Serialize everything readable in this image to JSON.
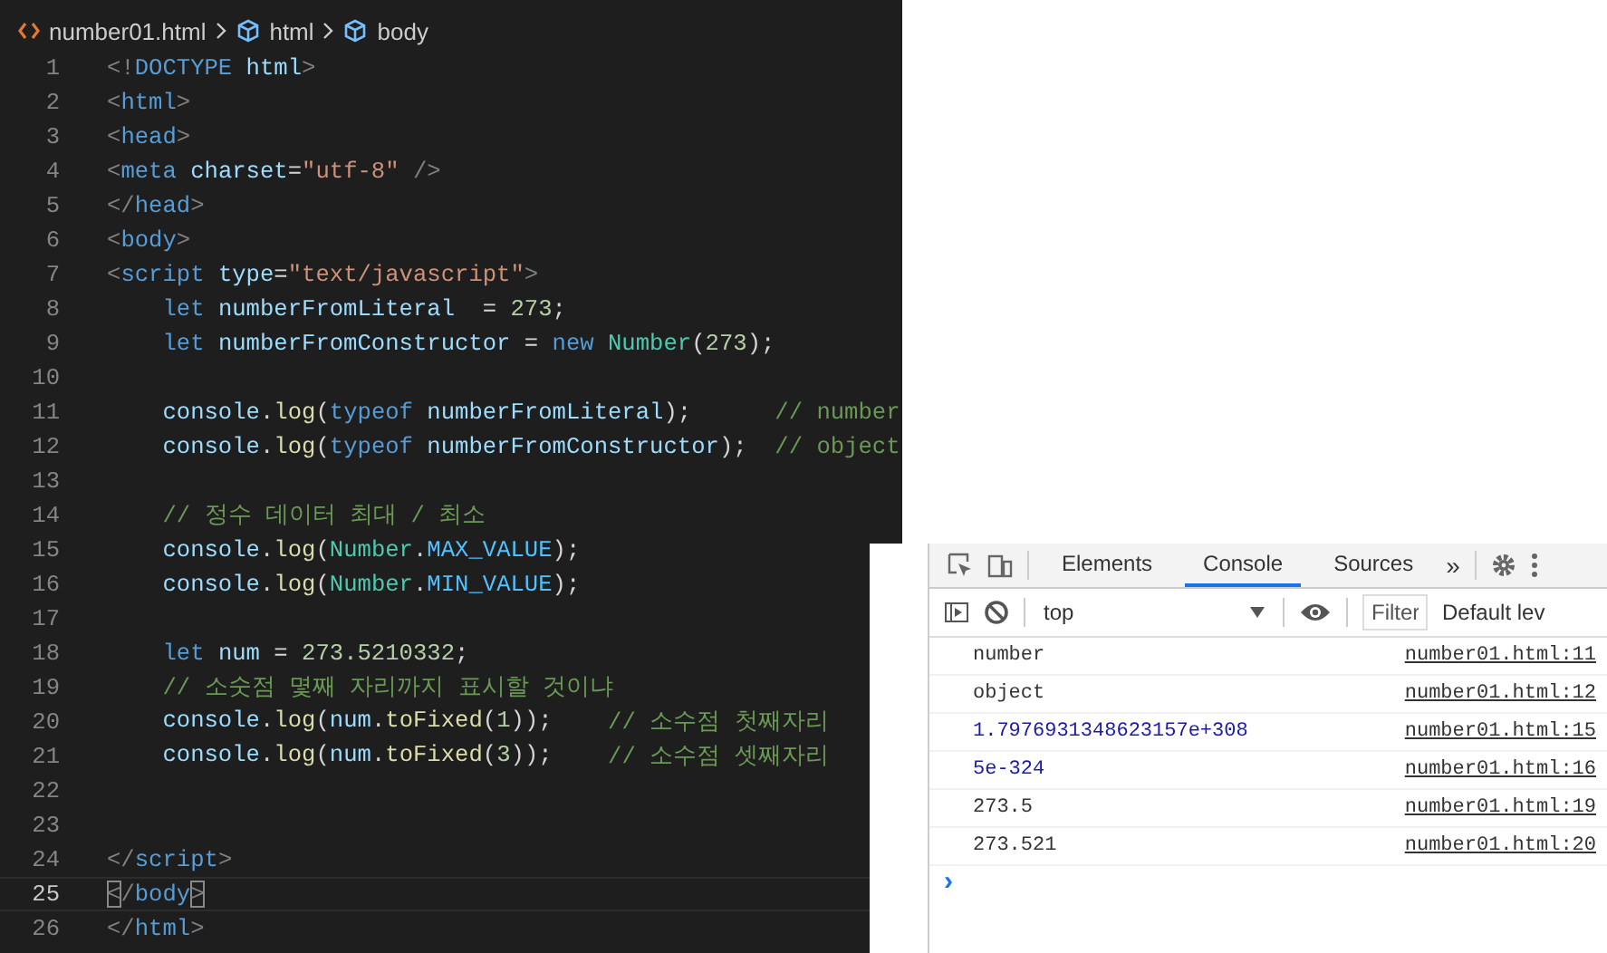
{
  "editor": {
    "breadcrumb": [
      {
        "kind": "file",
        "text": "number01.html"
      },
      {
        "kind": "element",
        "text": "html"
      },
      {
        "kind": "element",
        "text": "body"
      }
    ],
    "lines": [
      {
        "number": "1",
        "current": false,
        "tokens": [
          {
            "kind": "punct",
            "text": "<!"
          },
          {
            "kind": "tag",
            "text": "DOCTYPE"
          },
          {
            "kind": "attr",
            "text": " html"
          },
          {
            "kind": "punct",
            "text": ">"
          }
        ]
      },
      {
        "number": "2",
        "current": false,
        "tokens": [
          {
            "kind": "punct",
            "text": "<"
          },
          {
            "kind": "tag",
            "text": "html"
          },
          {
            "kind": "punct",
            "text": ">"
          }
        ]
      },
      {
        "number": "3",
        "current": false,
        "tokens": [
          {
            "kind": "punct",
            "text": "<"
          },
          {
            "kind": "tag",
            "text": "head"
          },
          {
            "kind": "punct",
            "text": ">"
          }
        ]
      },
      {
        "number": "4",
        "current": false,
        "tokens": [
          {
            "kind": "punct",
            "text": "<"
          },
          {
            "kind": "tag",
            "text": "meta"
          },
          {
            "kind": "attr",
            "text": " charset"
          },
          {
            "kind": "plain",
            "text": "="
          },
          {
            "kind": "string",
            "text": "\"utf-8\""
          },
          {
            "kind": "punct",
            "text": " />"
          }
        ]
      },
      {
        "number": "5",
        "current": false,
        "tokens": [
          {
            "kind": "punct",
            "text": "</"
          },
          {
            "kind": "tag",
            "text": "head"
          },
          {
            "kind": "punct",
            "text": ">"
          }
        ]
      },
      {
        "number": "6",
        "current": false,
        "tokens": [
          {
            "kind": "punct",
            "text": "<"
          },
          {
            "kind": "tag",
            "text": "body"
          },
          {
            "kind": "punct",
            "text": ">"
          }
        ]
      },
      {
        "number": "7",
        "current": false,
        "tokens": [
          {
            "kind": "punct",
            "text": "<"
          },
          {
            "kind": "tag",
            "text": "script"
          },
          {
            "kind": "attr",
            "text": " type"
          },
          {
            "kind": "plain",
            "text": "="
          },
          {
            "kind": "string",
            "text": "\"text/javascript\""
          },
          {
            "kind": "punct",
            "text": ">"
          }
        ]
      },
      {
        "number": "8",
        "current": false,
        "tokens": [
          {
            "kind": "keyword",
            "text": "    let"
          },
          {
            "kind": "variable",
            "text": " numberFromLiteral"
          },
          {
            "kind": "plain",
            "text": "  = "
          },
          {
            "kind": "number",
            "text": "273"
          },
          {
            "kind": "plain",
            "text": ";"
          }
        ]
      },
      {
        "number": "9",
        "current": false,
        "tokens": [
          {
            "kind": "keyword",
            "text": "    let"
          },
          {
            "kind": "variable",
            "text": " numberFromConstructor"
          },
          {
            "kind": "plain",
            "text": " = "
          },
          {
            "kind": "keyword",
            "text": "new"
          },
          {
            "kind": "class",
            "text": " Number"
          },
          {
            "kind": "plain",
            "text": "("
          },
          {
            "kind": "number",
            "text": "273"
          },
          {
            "kind": "plain",
            "text": ");"
          }
        ]
      },
      {
        "number": "10",
        "current": false
      },
      {
        "number": "11",
        "current": false,
        "tokens": [
          {
            "kind": "variable",
            "text": "    console"
          },
          {
            "kind": "plain",
            "text": "."
          },
          {
            "kind": "function",
            "text": "log"
          },
          {
            "kind": "plain",
            "text": "("
          },
          {
            "kind": "keyword",
            "text": "typeof"
          },
          {
            "kind": "variable",
            "text": " numberFromLiteral"
          },
          {
            "kind": "plain",
            "text": ");      "
          },
          {
            "kind": "comment",
            "text": "// number"
          }
        ]
      },
      {
        "number": "12",
        "current": false,
        "tokens": [
          {
            "kind": "variable",
            "text": "    console"
          },
          {
            "kind": "plain",
            "text": "."
          },
          {
            "kind": "function",
            "text": "log"
          },
          {
            "kind": "plain",
            "text": "("
          },
          {
            "kind": "keyword",
            "text": "typeof"
          },
          {
            "kind": "variable",
            "text": " numberFromConstructor"
          },
          {
            "kind": "plain",
            "text": ");  "
          },
          {
            "kind": "comment",
            "text": "// object"
          }
        ]
      },
      {
        "number": "13",
        "current": false
      },
      {
        "number": "14",
        "current": false,
        "tokens": [
          {
            "kind": "comment",
            "text": "    // 정수 데이터 최대 / 최소"
          }
        ]
      },
      {
        "number": "15",
        "current": false,
        "tokens": [
          {
            "kind": "variable",
            "text": "    console"
          },
          {
            "kind": "plain",
            "text": "."
          },
          {
            "kind": "function",
            "text": "log"
          },
          {
            "kind": "plain",
            "text": "("
          },
          {
            "kind": "class",
            "text": "Number"
          },
          {
            "kind": "plain",
            "text": "."
          },
          {
            "kind": "constant",
            "text": "MAX_VALUE"
          },
          {
            "kind": "plain",
            "text": ");"
          }
        ]
      },
      {
        "number": "16",
        "current": false,
        "tokens": [
          {
            "kind": "variable",
            "text": "    console"
          },
          {
            "kind": "plain",
            "text": "."
          },
          {
            "kind": "function",
            "text": "log"
          },
          {
            "kind": "plain",
            "text": "("
          },
          {
            "kind": "class",
            "text": "Number"
          },
          {
            "kind": "plain",
            "text": "."
          },
          {
            "kind": "constant",
            "text": "MIN_VALUE"
          },
          {
            "kind": "plain",
            "text": ");"
          }
        ]
      },
      {
        "number": "17",
        "current": false
      },
      {
        "number": "18",
        "current": false,
        "tokens": [
          {
            "kind": "keyword",
            "text": "    let"
          },
          {
            "kind": "variable",
            "text": " num"
          },
          {
            "kind": "plain",
            "text": " = "
          },
          {
            "kind": "number",
            "text": "273.5210332"
          },
          {
            "kind": "plain",
            "text": ";"
          }
        ]
      },
      {
        "number": "19",
        "current": false,
        "tokens": [
          {
            "kind": "comment",
            "text": "    // 소숫점 몇째 자리까지 표시할 것이냐"
          }
        ]
      },
      {
        "number": "20",
        "current": false,
        "tokens": [
          {
            "kind": "variable",
            "text": "    console"
          },
          {
            "kind": "plain",
            "text": "."
          },
          {
            "kind": "function",
            "text": "log"
          },
          {
            "kind": "plain",
            "text": "("
          },
          {
            "kind": "variable",
            "text": "num"
          },
          {
            "kind": "plain",
            "text": "."
          },
          {
            "kind": "function",
            "text": "toFixed"
          },
          {
            "kind": "plain",
            "text": "("
          },
          {
            "kind": "number",
            "text": "1"
          },
          {
            "kind": "plain",
            "text": "));    "
          },
          {
            "kind": "comment",
            "text": "// 소수점 첫째자리"
          }
        ]
      },
      {
        "number": "21",
        "current": false,
        "tokens": [
          {
            "kind": "variable",
            "text": "    console"
          },
          {
            "kind": "plain",
            "text": "."
          },
          {
            "kind": "function",
            "text": "log"
          },
          {
            "kind": "plain",
            "text": "("
          },
          {
            "kind": "variable",
            "text": "num"
          },
          {
            "kind": "plain",
            "text": "."
          },
          {
            "kind": "function",
            "text": "toFixed"
          },
          {
            "kind": "plain",
            "text": "("
          },
          {
            "kind": "number",
            "text": "3"
          },
          {
            "kind": "plain",
            "text": "));    "
          },
          {
            "kind": "comment",
            "text": "// 소수점 셋째자리"
          }
        ]
      },
      {
        "number": "22",
        "current": false
      },
      {
        "number": "23",
        "current": false
      },
      {
        "number": "24",
        "current": false,
        "tokens": [
          {
            "kind": "punct",
            "text": "</"
          },
          {
            "kind": "tag",
            "text": "script"
          },
          {
            "kind": "punct",
            "text": ">"
          }
        ]
      },
      {
        "number": "25",
        "current": true,
        "tokens": [
          {
            "kind": "matched",
            "text": "<"
          },
          {
            "kind": "punct",
            "text": "/"
          },
          {
            "kind": "tag",
            "text": "body"
          },
          {
            "kind": "matched",
            "text": ">"
          }
        ]
      },
      {
        "number": "26",
        "current": false,
        "tokens": [
          {
            "kind": "punct",
            "text": "</"
          },
          {
            "kind": "tag",
            "text": "html"
          },
          {
            "kind": "punct",
            "text": ">"
          }
        ]
      }
    ]
  },
  "devtools": {
    "tabs": [
      {
        "label": "Elements",
        "selected": false
      },
      {
        "label": "Console",
        "selected": true
      },
      {
        "label": "Sources",
        "selected": false
      }
    ],
    "more_tabs": "»",
    "context": "top",
    "filter": {
      "placeholder": "Filter"
    },
    "levels": "Default lev",
    "messages": [
      {
        "kind": "string",
        "text": "number",
        "source": "number01.html:11"
      },
      {
        "kind": "string",
        "text": "object",
        "source": "number01.html:12"
      },
      {
        "kind": "number",
        "text": "1.7976931348623157e+308",
        "source": "number01.html:15"
      },
      {
        "kind": "number",
        "text": "5e-324",
        "source": "number01.html:16"
      },
      {
        "kind": "string",
        "text": "273.5",
        "source": "number01.html:19"
      },
      {
        "kind": "string",
        "text": "273.521",
        "source": "number01.html:20"
      }
    ],
    "prompt": "›"
  }
}
